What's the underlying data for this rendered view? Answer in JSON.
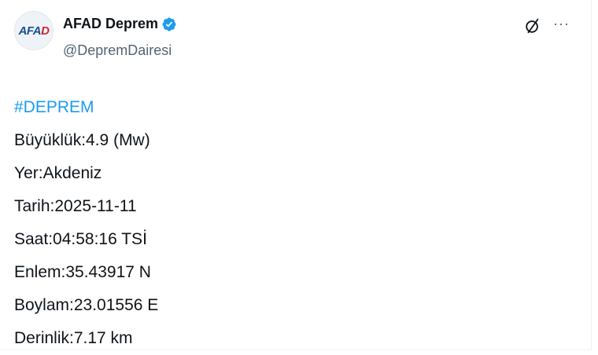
{
  "account": {
    "display_name": "AFAD Deprem",
    "handle": "@DepremDairesi",
    "avatar_logo_main": "AFA",
    "avatar_logo_accent": "D",
    "verified_icon": "verified-badge-icon",
    "brand_color": "#1d9bf0"
  },
  "actions": {
    "grok_icon": "grok-icon",
    "more_label": "···"
  },
  "post": {
    "hashtag": "#DEPREM",
    "lines": [
      "Büyüklük:4.9 (Mw)",
      "Yer:Akdeniz",
      "Tarih:2025-11-11",
      "Saat:04:58:16 TSİ",
      "Enlem:35.43917 N",
      "Boylam:23.01556 E",
      "Derinlik:7.17 km"
    ]
  }
}
